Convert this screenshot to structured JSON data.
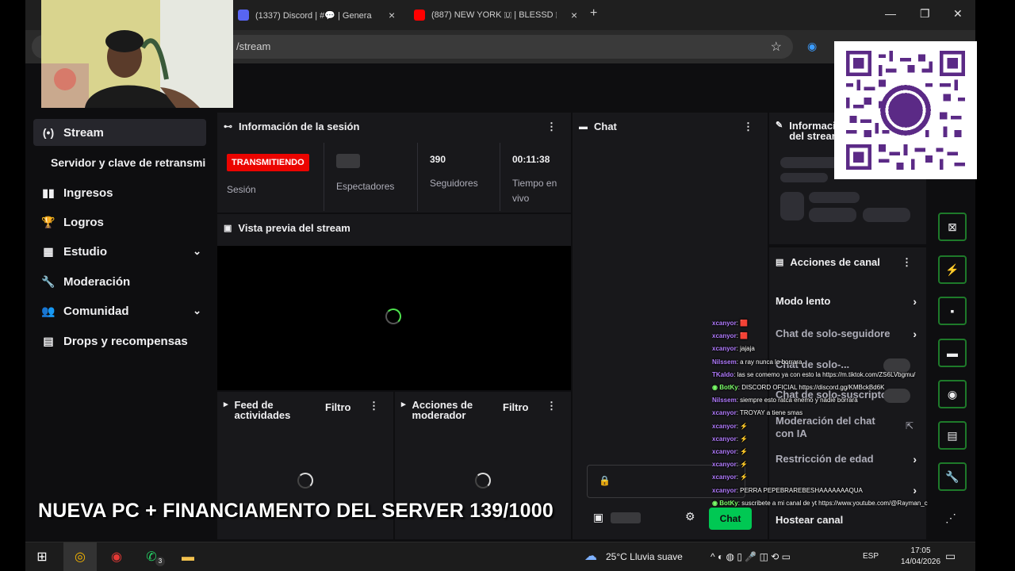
{
  "browser": {
    "tabs": [
      {
        "label": "(1337) Discord | #💬 | Genera",
        "favicon_color": "#5865f2"
      },
      {
        "label": "(887) NEW YORK 🇺 | BLESSD 🇨",
        "favicon_color": "#ff0000"
      }
    ],
    "new_tab": "+",
    "url_fragment": "/stream",
    "win_controls": {
      "minimize": "—",
      "maximize": "❐",
      "close": "✕"
    }
  },
  "sidebar": {
    "items": [
      {
        "label": "Stream",
        "icon": "broadcast-icon",
        "glyph": "(•)",
        "active": true
      },
      {
        "label": "Ingresos",
        "icon": "bar-chart-icon",
        "glyph": "▮▮"
      },
      {
        "label": "Logros",
        "icon": "trophy-icon",
        "glyph": "🏆"
      },
      {
        "label": "Estudio",
        "icon": "studio-icon",
        "glyph": "▦",
        "chevron": true
      },
      {
        "label": "Moderación",
        "icon": "wrench-icon",
        "glyph": "🔧"
      },
      {
        "label": "Comunidad",
        "icon": "people-icon",
        "glyph": "👥",
        "chevron": true
      },
      {
        "label": "Drops y recompensas",
        "icon": "drops-icon",
        "glyph": "▤"
      }
    ],
    "sub_item": "Servidor y clave de retransmi",
    "chevron": "⌄"
  },
  "session": {
    "title": "Información de la sesión",
    "live_badge": "TRANSMITIENDO",
    "session_label": "Sesión",
    "viewers_label": "Espectadores",
    "followers_value": "390",
    "followers_label": "Seguidores",
    "time_value": "00:11:38",
    "time_label": "Tiempo en vivo"
  },
  "preview": {
    "title": "Vista previa del stream"
  },
  "activity_feed": {
    "title": "Feed de actividades",
    "filter": "Filtro"
  },
  "mod_actions": {
    "title": "Acciones de moderador",
    "filter": "Filtro"
  },
  "chat": {
    "title": "Chat",
    "send_button": "Chat",
    "lock": "🔒"
  },
  "stream_info": {
    "title": "Información del stream"
  },
  "channel_actions": {
    "title": "Acciones de canal",
    "items": [
      {
        "label": "Modo lento"
      },
      {
        "label": "Chat de solo-seguidore"
      },
      {
        "label": "Chat de solo-..."
      },
      {
        "label": "Chat de solo-suscriptor"
      },
      {
        "label": "Moderación del chat con IA"
      },
      {
        "label": "Restricción de edad"
      },
      {
        "label": "Hostear canal"
      }
    ]
  },
  "overlay_chat": [
    {
      "user": "xcanyor",
      "text": ": 🟥"
    },
    {
      "user": "xcanyor",
      "text": ": 🟥"
    },
    {
      "user": "xcanyor",
      "text": ": jajaja"
    },
    {
      "user": "Nilssem",
      "text": ": a ray nunca lo borrara"
    },
    {
      "user": "TKaldo",
      "text": ": las se comemo ya con esto la https://m.tiktok.com/ZS6LVbgmu/"
    },
    {
      "user": "◉ BotKy",
      "text": ": DISCORD OFICIAL https://discord.gg/KMBckBd6K",
      "green": true
    },
    {
      "user": "Nilssem",
      "text": ": siempre esto ratca enemo y nadie borrara"
    },
    {
      "user": "xcanyor",
      "text": ": TROYAY a tiene smas"
    },
    {
      "user": "xcanyor",
      "text": ": ⚡"
    },
    {
      "user": "xcanyor",
      "text": ": ⚡"
    },
    {
      "user": "xcanyor",
      "text": ": ⚡"
    },
    {
      "user": "xcanyor",
      "text": ": ⚡"
    },
    {
      "user": "xcanyor",
      "text": ": ⚡"
    },
    {
      "user": "xcanyor",
      "text": ": PERRA PEPEBRAREBESHAAAAAAAQUA"
    },
    {
      "user": "◉ BotKy",
      "text": ": suscribete a mi canal de yt https://www.youtube.com/@Rayman_c",
      "green": true
    }
  ],
  "banner": "NUEVA PC + FINANCIAMENTO DEL SERVER 139/1000",
  "taskbar": {
    "weather": "25°C Lluvia suave",
    "lang": "ESP",
    "time": "17:05",
    "date": "14/04/2026",
    "whatsapp_badge": "3"
  }
}
